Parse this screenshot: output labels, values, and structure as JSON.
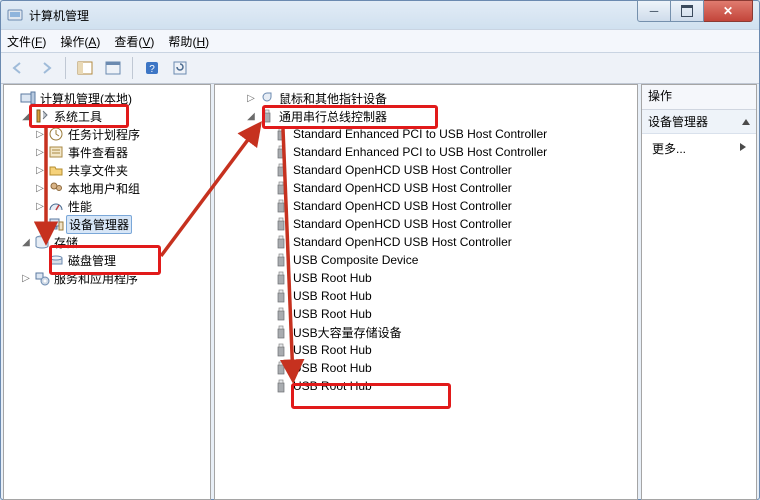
{
  "window": {
    "title": "计算机管理"
  },
  "menubar": [
    {
      "label": "文件",
      "acc": "F"
    },
    {
      "label": "操作",
      "acc": "A"
    },
    {
      "label": "查看",
      "acc": "V"
    },
    {
      "label": "帮助",
      "acc": "H"
    }
  ],
  "left_tree": {
    "root": {
      "label": "计算机管理(本地)"
    },
    "system_tools": {
      "label": "系统工具",
      "children": [
        {
          "label": "任务计划程序"
        },
        {
          "label": "事件查看器"
        },
        {
          "label": "共享文件夹"
        },
        {
          "label": "本地用户和组"
        },
        {
          "label": "性能"
        },
        {
          "label": "设备管理器",
          "selected": true
        }
      ]
    },
    "storage": {
      "label": "存储",
      "children": [
        {
          "label": "磁盘管理"
        }
      ]
    },
    "services": {
      "label": "服务和应用程序"
    }
  },
  "mid_tree": {
    "top_peek": {
      "label": "鼠标和其他指针设备"
    },
    "usb_root": {
      "label": "通用串行总线控制器"
    },
    "usb_children": [
      {
        "label": "Standard Enhanced PCI to USB Host Controller"
      },
      {
        "label": "Standard Enhanced PCI to USB Host Controller"
      },
      {
        "label": "Standard OpenHCD USB Host Controller"
      },
      {
        "label": "Standard OpenHCD USB Host Controller"
      },
      {
        "label": "Standard OpenHCD USB Host Controller"
      },
      {
        "label": "Standard OpenHCD USB Host Controller"
      },
      {
        "label": "Standard OpenHCD USB Host Controller"
      },
      {
        "label": "USB Composite Device"
      },
      {
        "label": "USB Root Hub"
      },
      {
        "label": "USB Root Hub"
      },
      {
        "label": "USB Root Hub"
      },
      {
        "label": "USB大容量存储设备",
        "highlighted": true
      },
      {
        "label": "USB Root Hub"
      },
      {
        "label": "USB Root Hub"
      },
      {
        "label": "USB Root Hub"
      }
    ]
  },
  "actions": {
    "header": "操作",
    "sub": "设备管理器",
    "more": "更多..."
  }
}
